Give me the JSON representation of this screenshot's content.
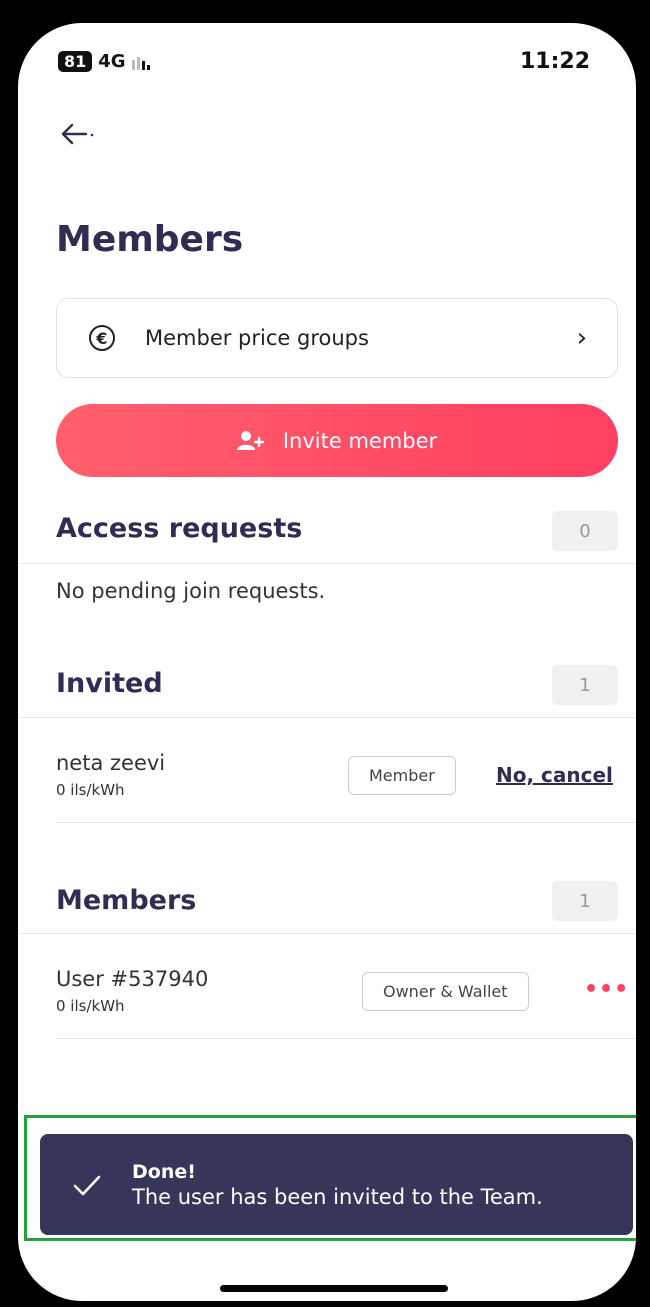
{
  "status_bar": {
    "battery": "81",
    "network": "4G",
    "time": "11:22"
  },
  "header": {
    "back_icon": "arrow-left-icon",
    "title": "Members"
  },
  "price_groups": {
    "icon": "euro-icon",
    "label": "Member price groups",
    "chevron": "›"
  },
  "invite_button": {
    "icon": "add-user-icon",
    "label": "Invite member"
  },
  "access_requests": {
    "title": "Access requests",
    "count": "0",
    "empty_text": "No pending join requests."
  },
  "invited": {
    "title": "Invited",
    "count": "1",
    "items": [
      {
        "name": "neta zeevi",
        "rate": "0 ils/kWh",
        "role": "Member",
        "action": "No, cancel"
      }
    ]
  },
  "members": {
    "title": "Members",
    "count": "1",
    "items": [
      {
        "name": "User #537940",
        "rate": "0 ils/kWh",
        "role": "Owner & Wallet",
        "menu": "•••"
      }
    ]
  },
  "toast": {
    "icon": "checkmark-icon",
    "title": "Done!",
    "message": "The user has been invited to the Team."
  },
  "colors": {
    "accent": "#ff3f61",
    "primary_text": "#2f2d52",
    "toast_bg": "#36355a",
    "highlight_border": "#24a043"
  }
}
